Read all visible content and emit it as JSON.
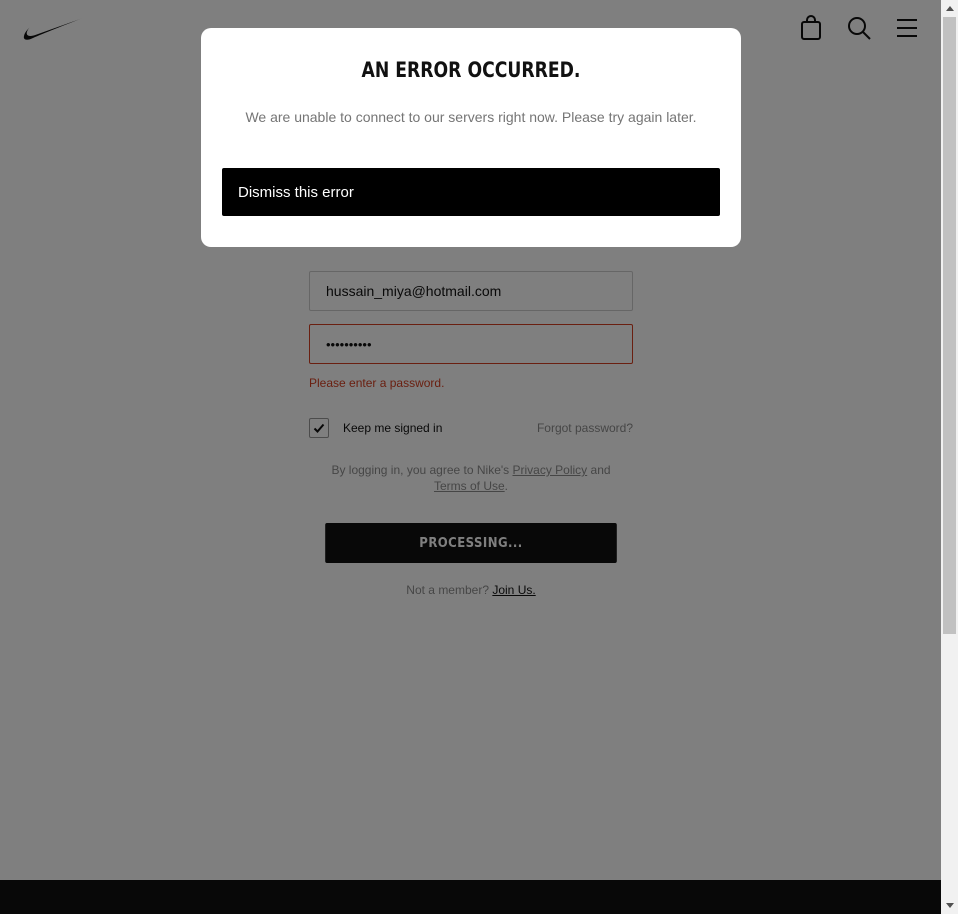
{
  "header": {
    "logo_icon": "swoosh-logo",
    "icons": [
      "bag-icon",
      "search-icon",
      "menu-icon"
    ]
  },
  "login": {
    "email_value": "hussain_miya@hotmail.com",
    "password_value": "••••••••••",
    "password_error": "Please enter a password.",
    "keep_signed_in_label": "Keep me signed in",
    "keep_signed_in_checked": true,
    "forgot_password": "Forgot password?",
    "terms_prefix": "By logging in, you agree to Nike's ",
    "privacy_policy": "Privacy Policy",
    "terms_and": " and",
    "terms_of_use": "Terms of Use",
    "terms_suffix": ".",
    "submit_label": "PROCESSING...",
    "not_member": "Not a member? ",
    "join_us": "Join Us."
  },
  "modal": {
    "title": "AN ERROR OCCURRED.",
    "message": "We are unable to connect to our servers right now. Please try again later.",
    "dismiss_label": "Dismiss this error"
  },
  "colors": {
    "error": "#d43f21",
    "overlay": "rgba(0,0,0,0.5)",
    "button": "#111111"
  }
}
